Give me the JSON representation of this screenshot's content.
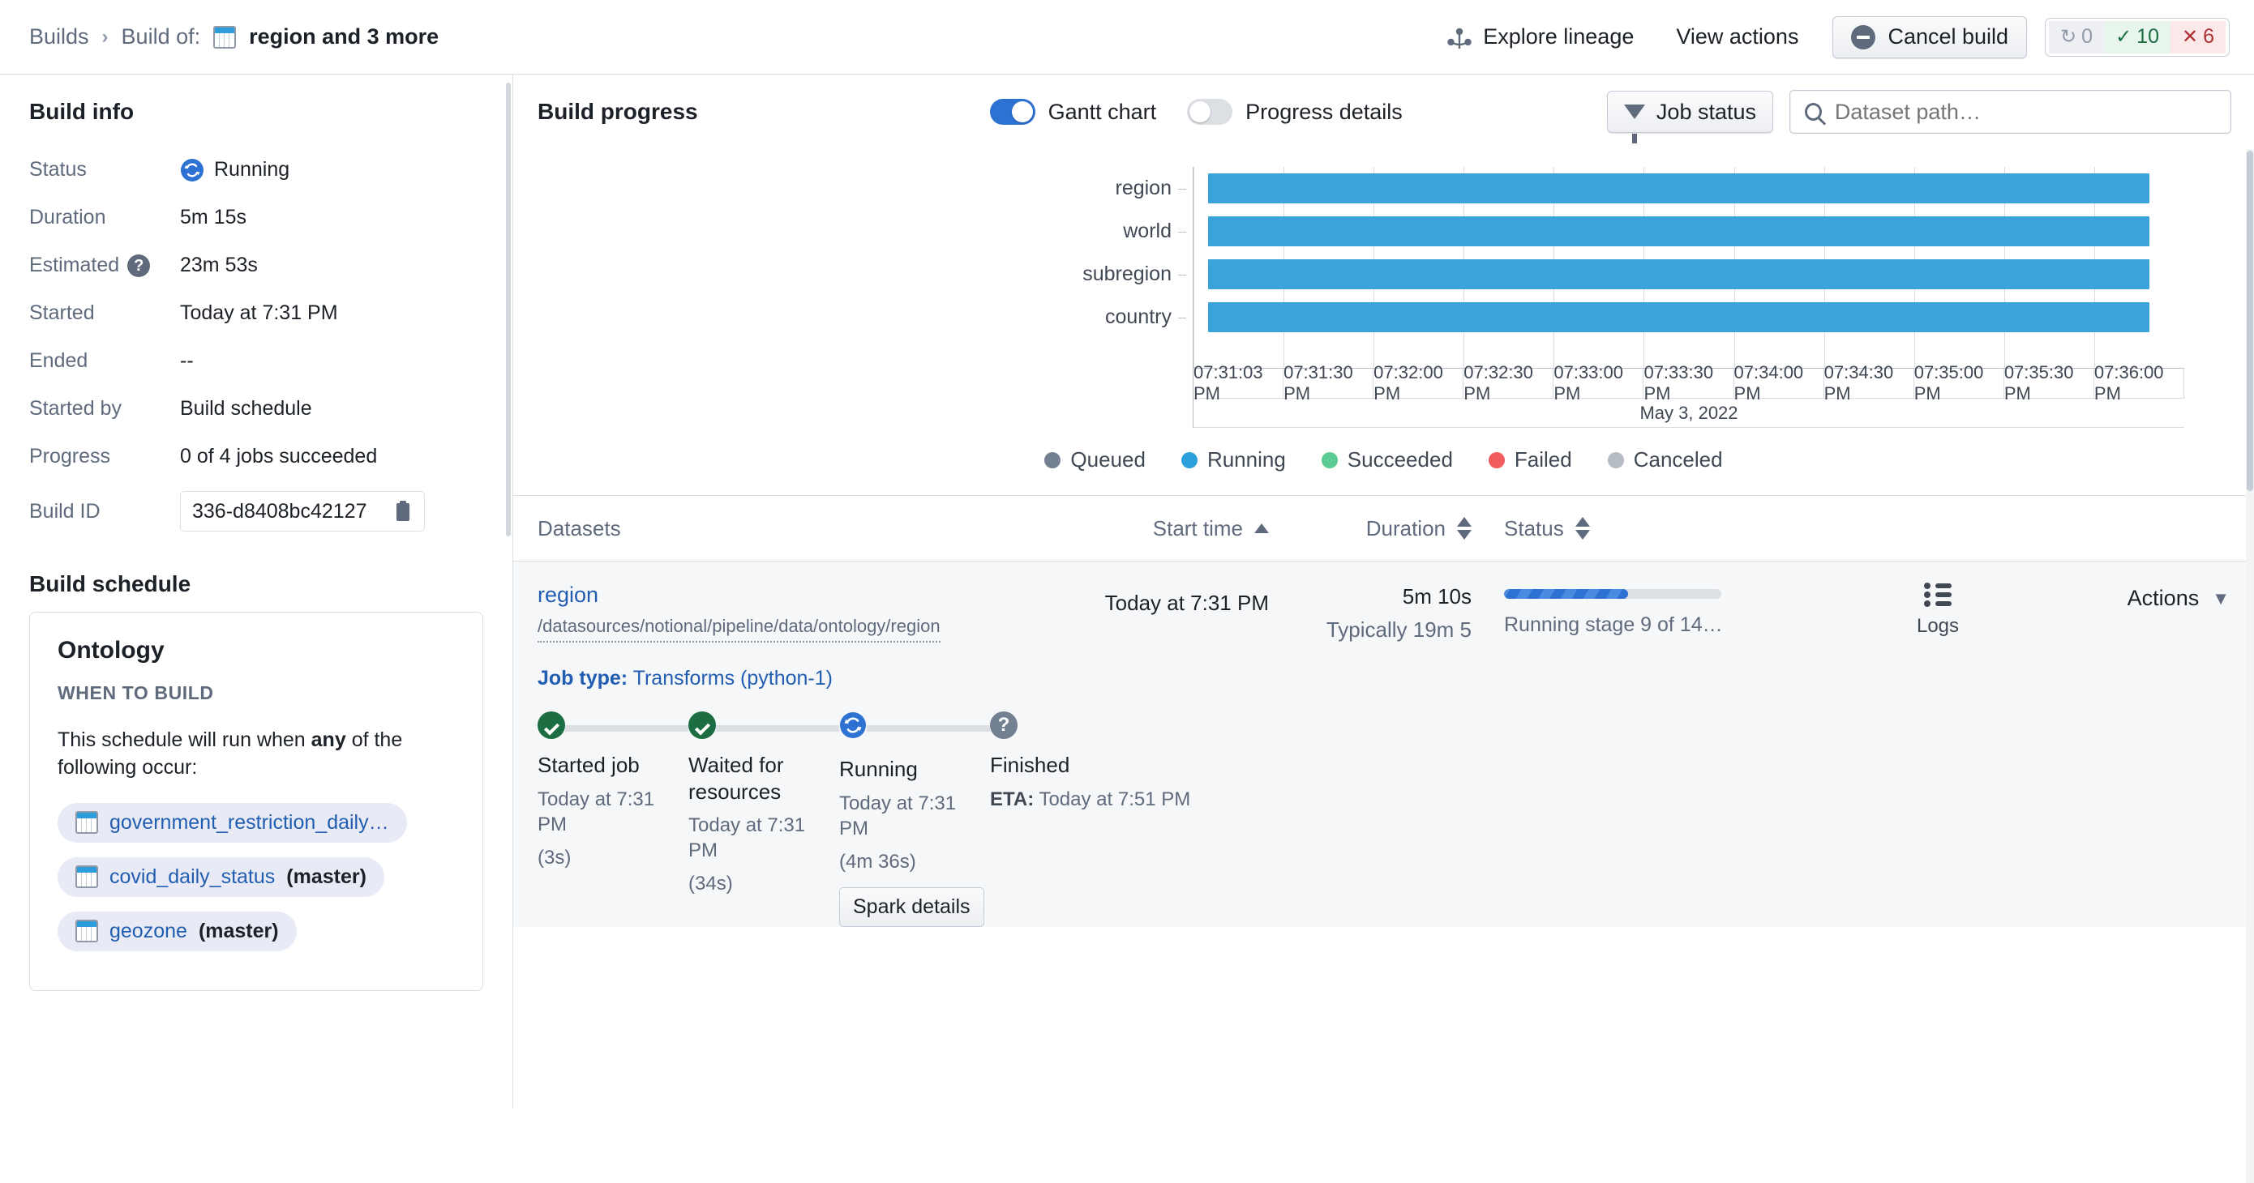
{
  "topbar": {
    "breadcrumb_root": "Builds",
    "breadcrumb_sep": "›",
    "breadcrumb_label": "Build of:",
    "breadcrumb_title": "region and 3 more",
    "explore_lineage": "Explore lineage",
    "view_actions": "View actions",
    "cancel_build": "Cancel build",
    "status_counts": {
      "queued": "0",
      "succeeded": "10",
      "failed": "6"
    },
    "status_icons": {
      "queued": "↻",
      "succeeded": "✓",
      "failed": "✕"
    }
  },
  "build_info": {
    "heading": "Build info",
    "rows": [
      {
        "key": "Status",
        "value": "Running",
        "icon": "running-icon"
      },
      {
        "key": "Duration",
        "value": "5m 15s"
      },
      {
        "key": "Estimated",
        "value": "23m 53s",
        "help": "?"
      },
      {
        "key": "Started",
        "value": "Today at 7:31 PM"
      },
      {
        "key": "Ended",
        "value": "--"
      },
      {
        "key": "Started by",
        "value": "Build schedule"
      },
      {
        "key": "Progress",
        "value": "0 of 4 jobs succeeded"
      }
    ],
    "build_id_label": "Build ID",
    "build_id_value": "336-d8408bc42127"
  },
  "build_schedule": {
    "heading": "Build schedule",
    "card_title": "Ontology",
    "card_subtitle": "WHEN TO BUILD",
    "desc_before": "This schedule will run when ",
    "desc_bold": "any",
    "desc_after": " of the following occur:",
    "tags": [
      {
        "name": "government_restriction_daily…",
        "branch": ""
      },
      {
        "name": "covid_daily_status",
        "branch": "(master)"
      },
      {
        "name": "geozone",
        "branch": "(master)"
      }
    ]
  },
  "build_progress": {
    "title": "Build progress",
    "toggle_gantt": {
      "label": "Gantt chart",
      "on": true
    },
    "toggle_details": {
      "label": "Progress details",
      "on": false
    },
    "job_status_button": "Job status",
    "search_placeholder": "Dataset path…"
  },
  "chart_data": {
    "type": "bar",
    "title": "Build progress Gantt chart",
    "xlabel": "May 3, 2022",
    "ylabel": "",
    "categories": [
      "region",
      "world",
      "subregion",
      "country"
    ],
    "tick_labels": [
      "07:31:03 PM",
      "07:31:30 PM",
      "07:32:00 PM",
      "07:32:30 PM",
      "07:33:00 PM",
      "07:33:30 PM",
      "07:34:00 PM",
      "07:34:30 PM",
      "07:35:00 PM",
      "07:35:30 PM",
      "07:36:00 PM"
    ],
    "date_label": "May 3, 2022",
    "bar_color": "#3ba3d9",
    "bars": [
      {
        "label": "region",
        "start_pct": 1.5,
        "end_pct": 96.5,
        "status": "Running"
      },
      {
        "label": "world",
        "start_pct": 1.5,
        "end_pct": 96.5,
        "status": "Running"
      },
      {
        "label": "subregion",
        "start_pct": 1.5,
        "end_pct": 96.5,
        "status": "Running"
      },
      {
        "label": "country",
        "start_pct": 1.5,
        "end_pct": 96.5,
        "status": "Running"
      }
    ],
    "legend_position": "bottom",
    "legend": [
      {
        "label": "Queued",
        "color": "#738091"
      },
      {
        "label": "Running",
        "color": "#2ba0db"
      },
      {
        "label": "Succeeded",
        "color": "#5dcb92"
      },
      {
        "label": "Failed",
        "color": "#f25c5c"
      },
      {
        "label": "Canceled",
        "color": "#b6bcc4"
      }
    ]
  },
  "table": {
    "headers": {
      "datasets": "Datasets",
      "start_time": "Start time",
      "duration": "Duration",
      "status": "Status"
    },
    "rows": [
      {
        "dataset_name": "region",
        "dataset_path": "/datasources/notional/pipeline/data/ontology/region",
        "start_time": "Today at 7:31 PM",
        "duration": "5m 10s",
        "duration_typical": "Typically 19m 5",
        "progress_pct": 57,
        "progress_text": "Running stage 9 of 14…",
        "logs_label": "Logs",
        "actions_label": "Actions",
        "actions_caret": "▼",
        "job_type_label": "Job type:",
        "job_type_value": "Transforms (python-1)",
        "steps": [
          {
            "title": "Started job",
            "sub1": "Today at 7:31 PM",
            "sub2": "(3s)",
            "state": "done"
          },
          {
            "title": "Waited for resources",
            "sub1": "Today at 7:31 PM",
            "sub2": "(34s)",
            "state": "done"
          },
          {
            "title": "Running",
            "sub1": "Today at 7:31 PM",
            "sub2": "(4m 36s)",
            "state": "running",
            "button": "Spark details"
          },
          {
            "title": "Finished",
            "sub1_bold": "ETA:",
            "sub1": " Today at 7:51 PM",
            "sub2": "",
            "state": "unknown"
          }
        ]
      }
    ]
  }
}
